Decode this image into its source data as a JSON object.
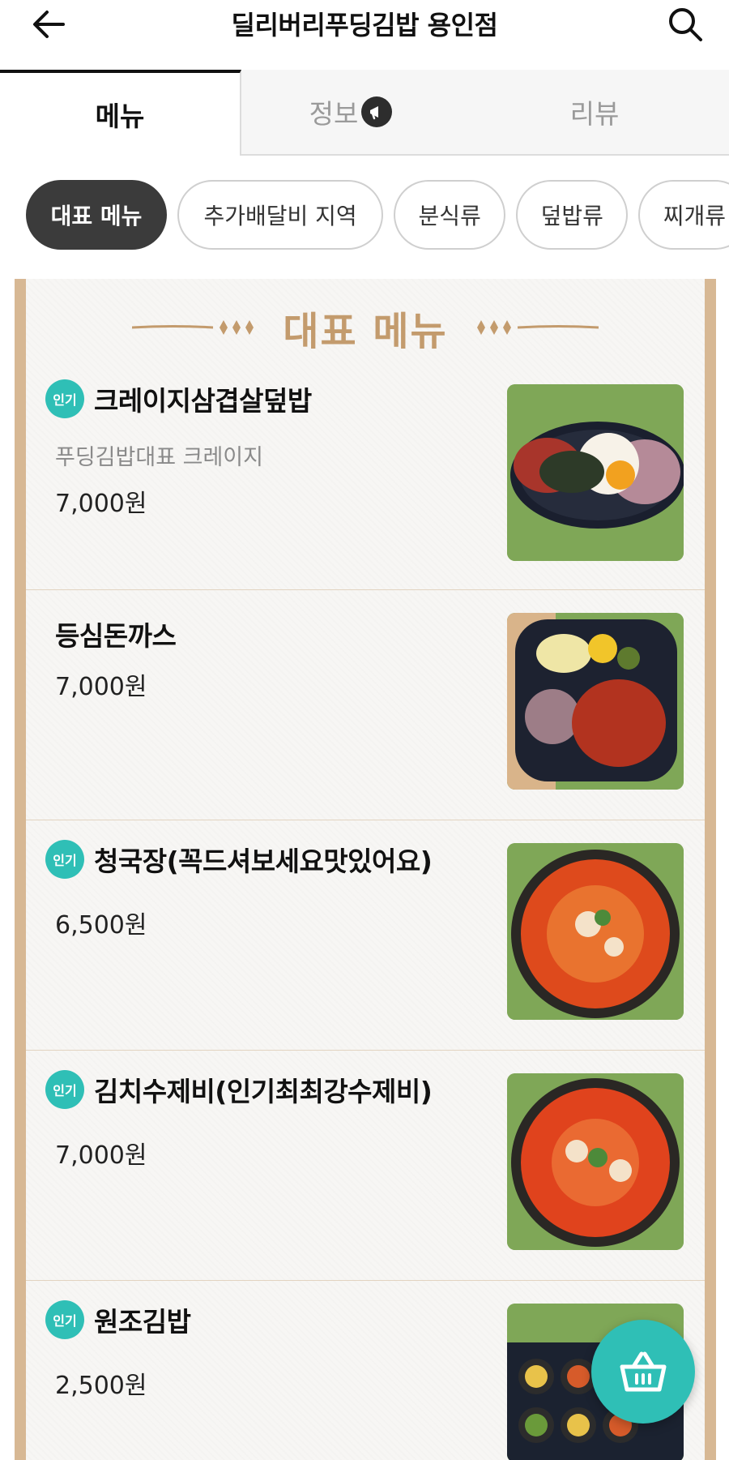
{
  "header": {
    "title": "딜리버리푸딩김밥 용인점",
    "back_icon": "arrow-left-icon",
    "search_icon": "search-icon"
  },
  "tabs": [
    {
      "label": "메뉴",
      "active": true
    },
    {
      "label": "정보",
      "active": false,
      "badge_icon": "megaphone-icon"
    },
    {
      "label": "리뷰",
      "active": false
    }
  ],
  "categories": [
    {
      "label": "대표 메뉴",
      "active": true
    },
    {
      "label": "추가배달비 지역",
      "active": false
    },
    {
      "label": "분식류",
      "active": false
    },
    {
      "label": "덮밥류",
      "active": false
    },
    {
      "label": "찌개류",
      "active": false
    }
  ],
  "section": {
    "title": "대표 메뉴"
  },
  "menu": [
    {
      "name": "크레이지삼겹살덮밥",
      "popular": true,
      "badge": "인기",
      "description": "푸딩김밥대표 크레이지",
      "price": "7,000원"
    },
    {
      "name": "등심돈까스",
      "popular": false,
      "price": "7,000원"
    },
    {
      "name": "청국장(꼭드셔보세요맛있어요)",
      "popular": true,
      "badge": "인기",
      "price": "6,500원"
    },
    {
      "name": "김치수제비(인기최최강수제비)",
      "popular": true,
      "badge": "인기",
      "price": "7,000원"
    },
    {
      "name": "원조김밥",
      "popular": true,
      "badge": "인기",
      "price": "2,500원"
    }
  ],
  "cart": {
    "icon": "shopping-basket-icon"
  },
  "colors": {
    "accent": "#2fbfb6",
    "section_title": "#c39b6d",
    "panel_border": "#d7b894",
    "chip_active": "#3b3b3b"
  }
}
